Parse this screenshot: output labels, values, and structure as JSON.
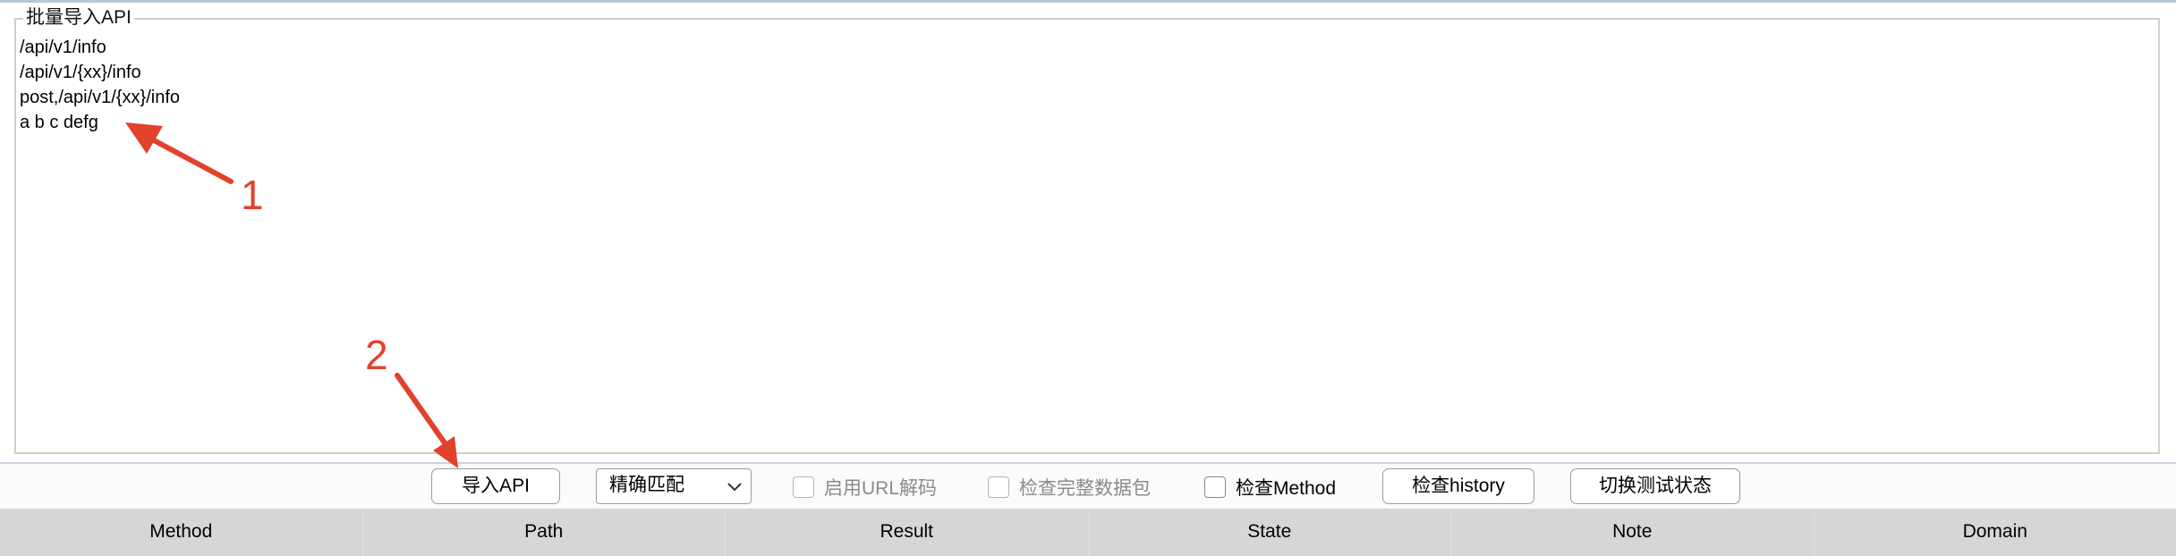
{
  "import_panel": {
    "title": "批量导入API",
    "lines": [
      "/api/v1/info",
      "/api/v1/{xx}/info",
      "post,/api/v1/{xx}/info",
      "a b c defg"
    ]
  },
  "toolbar": {
    "import_button": "导入API",
    "match_select": {
      "selected": "精确匹配"
    },
    "url_decode_checkbox": {
      "label": "启用URL解码",
      "checked": false,
      "enabled": false
    },
    "full_packet_checkbox": {
      "label": "检查完整数据包",
      "checked": false,
      "enabled": false
    },
    "method_checkbox": {
      "label": "检查Method",
      "checked": false,
      "enabled": true
    },
    "history_button": "检查history",
    "toggle_button": "切换测试状态"
  },
  "table": {
    "columns": [
      "Method",
      "Path",
      "Result",
      "State",
      "Note",
      "Domain"
    ]
  },
  "annotations": {
    "marker_1": "1",
    "marker_2": "2",
    "color": "#e2412c"
  }
}
